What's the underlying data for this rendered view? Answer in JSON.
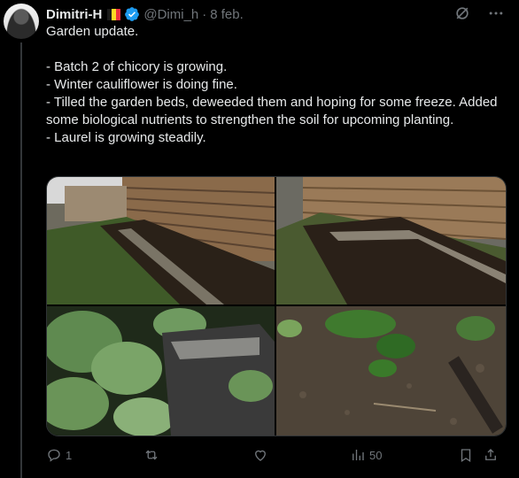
{
  "author": {
    "name": "Dimitri-H",
    "handle": "@Dimi_h",
    "separator": "·",
    "date": "8 feb."
  },
  "post": {
    "text": "Garden update.\n\n- Batch 2 of chicory is growing.\n- Winter cauliflower is doing fine.\n- Tilled the garden beds, deweeded them and hoping for some freeze. Added some biological nutrients to strengthen the soil for upcoming planting.\n- Laurel is growing steadily."
  },
  "media": {
    "photos": [
      {
        "name": "garden-beds-photo-1"
      },
      {
        "name": "garden-beds-photo-2"
      },
      {
        "name": "cauliflower-photo"
      },
      {
        "name": "laurel-photo"
      }
    ]
  },
  "actions": {
    "reply_count": "1",
    "repost_count": "",
    "like_count": "",
    "views_count": "50"
  },
  "colors": {
    "background": "#000000",
    "text": "#e7e9ea",
    "muted": "#71767b",
    "verified": "#1d9bf0",
    "border": "#2f3336"
  },
  "icons": [
    "avatar",
    "belgium-flag-icon",
    "verified-badge-icon",
    "grok-icon",
    "more-icon",
    "reply-icon",
    "repost-icon",
    "like-icon",
    "views-icon",
    "bookmark-icon",
    "share-icon"
  ]
}
